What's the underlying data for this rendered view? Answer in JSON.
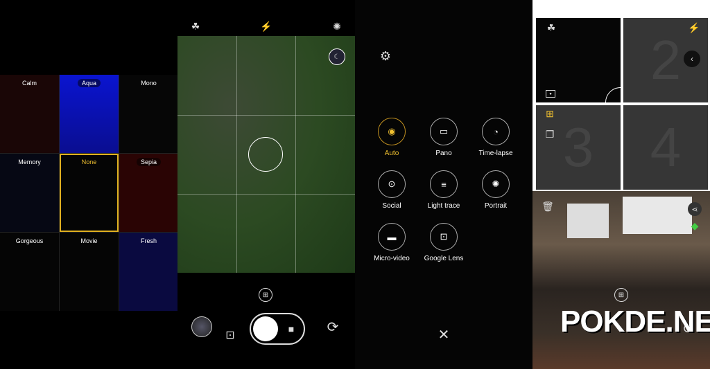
{
  "filters": {
    "items": [
      {
        "label": "Calm",
        "bg": "#1a0606"
      },
      {
        "label": "Aqua",
        "bg": "#0a14c8"
      },
      {
        "label": "Mono",
        "bg": "#060606"
      },
      {
        "label": "Memory",
        "bg": "#060814"
      },
      {
        "label": "None",
        "bg": "#050505",
        "selected": true
      },
      {
        "label": "Sepia",
        "bg": "#2a0404"
      },
      {
        "label": "Gorgeous",
        "bg": "#050505"
      },
      {
        "label": "Movie",
        "bg": "#050505"
      },
      {
        "label": "Fresh",
        "bg": "#0a0a40"
      }
    ]
  },
  "modes": {
    "items": [
      {
        "label": "Auto",
        "icon": "camera-icon",
        "glyph": "◉",
        "active": true
      },
      {
        "label": "Pano",
        "icon": "panorama-icon",
        "glyph": "▭"
      },
      {
        "label": "Time-lapse",
        "icon": "timelapse-icon",
        "glyph": "◔"
      },
      {
        "label": "Social",
        "icon": "social-icon",
        "glyph": "⊙"
      },
      {
        "label": "Light trace",
        "icon": "light-trace-icon",
        "glyph": "≡"
      },
      {
        "label": "Portrait",
        "icon": "aperture-icon",
        "glyph": "✺"
      },
      {
        "label": "Micro-video",
        "icon": "clapper-icon",
        "glyph": "▬"
      },
      {
        "label": "Google Lens",
        "icon": "lens-icon",
        "glyph": "⊡"
      }
    ]
  },
  "multi": {
    "tiles": [
      "2",
      "3",
      "4"
    ]
  },
  "watermark": "POKDE.NET",
  "accent": "#f0c030"
}
